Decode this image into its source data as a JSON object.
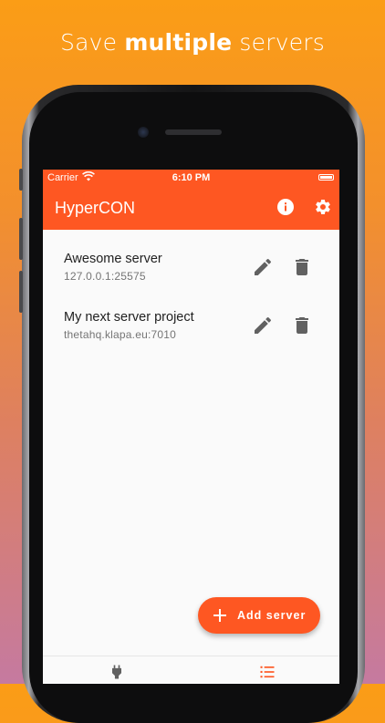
{
  "promo": {
    "prefix": "Save ",
    "bold": "multiple",
    "suffix": " servers"
  },
  "status_bar": {
    "carrier": "Carrier",
    "time": "6:10 PM"
  },
  "app_bar": {
    "title": "HyperCON",
    "info_icon": "info-icon",
    "settings_icon": "gear-icon"
  },
  "servers": [
    {
      "name": "Awesome server",
      "address": "127.0.0.1:25575"
    },
    {
      "name": "My next server project",
      "address": "thetahq.klapa.eu:7010"
    }
  ],
  "fab": {
    "label": "Add server",
    "icon": "plus-icon"
  },
  "bottom_nav": [
    {
      "icon": "plug-icon",
      "active": false
    },
    {
      "icon": "list-icon",
      "active": true
    }
  ],
  "colors": {
    "accent": "#fe5722",
    "icon_gray": "#616161"
  }
}
